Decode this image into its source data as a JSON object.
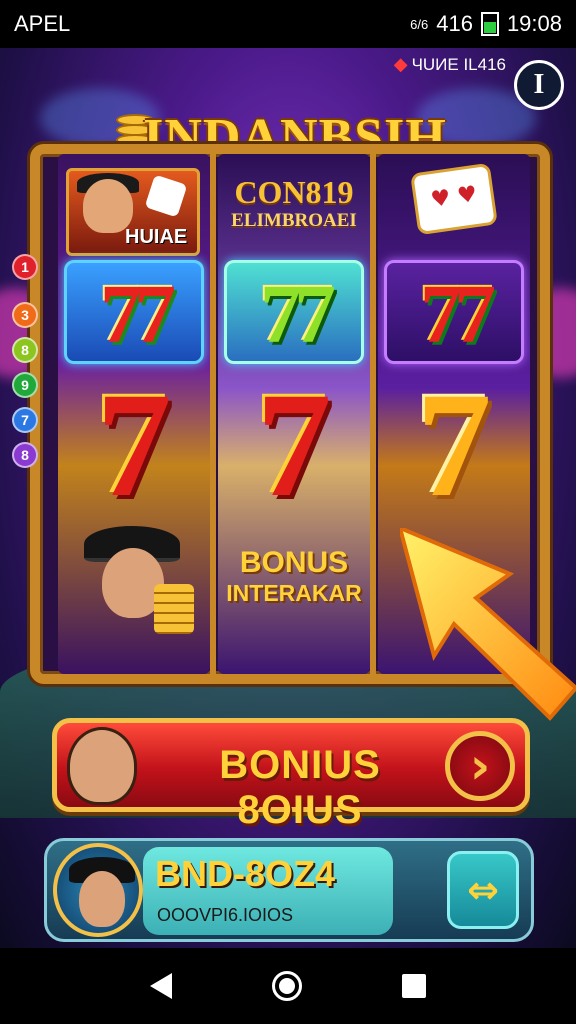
{
  "status_bar": {
    "carrier": "APEL",
    "signal_top": "6/6",
    "network": "416",
    "time": "19:08",
    "battery_icon": "battery-icon"
  },
  "game": {
    "balance_label": "ЧUИE IL416",
    "info_button": "I",
    "title": "INDANBSIH",
    "reels": {
      "reel1_top_label": "HUIAE",
      "reel2_top_line1": "CON819",
      "reel2_top_line2": "ELIMBROAEI",
      "reel2_bonus_line1": "BONUS",
      "reel2_bonus_line2": "INTERAKAR",
      "symbol_77": "77",
      "symbol_7": "7"
    },
    "side_dots": [
      "1",
      "3",
      "8",
      "9",
      "7",
      "8"
    ],
    "bonus_button": "BONIUS 8OIUS",
    "bonus_arrow": "›",
    "player": {
      "code": "BND-8OZ4",
      "sub": "OOOVPI6.IOIOS",
      "swap_icon": "⇔"
    }
  },
  "colors": {
    "gold": "#ffd23a",
    "frame": "#c88828",
    "red": "#c2121a",
    "teal": "#3cb0b5"
  },
  "icons": {
    "nav_back": "back-triangle-icon",
    "nav_home": "home-circle-icon",
    "nav_recent": "recents-square-icon"
  }
}
